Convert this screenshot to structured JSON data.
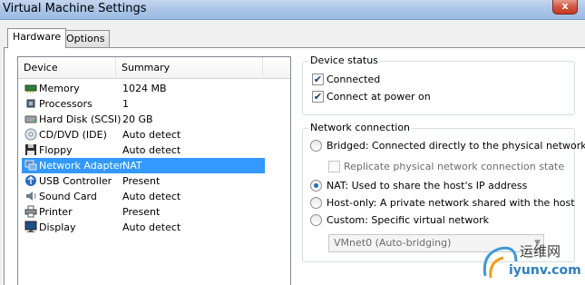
{
  "window": {
    "title": "Virtual Machine Settings",
    "close_glyph": "x"
  },
  "tabs": [
    {
      "label": "Hardware",
      "active": true
    },
    {
      "label": "Options",
      "active": false
    }
  ],
  "device_list": {
    "columns": [
      "Device",
      "Summary"
    ],
    "rows": [
      {
        "device": "Memory",
        "summary": "1024 MB",
        "icon": "memory-icon"
      },
      {
        "device": "Processors",
        "summary": "1",
        "icon": "processor-icon"
      },
      {
        "device": "Hard Disk (SCSI)",
        "summary": "20 GB",
        "icon": "hard-disk-icon"
      },
      {
        "device": "CD/DVD (IDE)",
        "summary": "Auto detect",
        "icon": "cd-dvd-icon"
      },
      {
        "device": "Floppy",
        "summary": "Auto detect",
        "icon": "floppy-icon"
      },
      {
        "device": "Network Adapter",
        "summary": "NAT",
        "icon": "network-adapter-icon",
        "selected": true
      },
      {
        "device": "USB Controller",
        "summary": "Present",
        "icon": "usb-icon"
      },
      {
        "device": "Sound Card",
        "summary": "Auto detect",
        "icon": "sound-card-icon"
      },
      {
        "device": "Printer",
        "summary": "Present",
        "icon": "printer-icon"
      },
      {
        "device": "Display",
        "summary": "Auto detect",
        "icon": "display-icon"
      }
    ]
  },
  "device_status": {
    "label": "Device status",
    "connected": {
      "label": "Connected",
      "checked": true
    },
    "connect_at_power_on": {
      "label": "Connect at power on",
      "checked": true
    }
  },
  "network_connection": {
    "label": "Network connection",
    "bridged": {
      "label": "Bridged: Connected directly to the physical network",
      "checked": false
    },
    "replicate": {
      "label": "Replicate physical network connection state",
      "checked": false,
      "disabled": true
    },
    "nat": {
      "label": "NAT: Used to share the host's IP address",
      "checked": true
    },
    "host_only": {
      "label": "Host-only: A private network shared with the host",
      "checked": false
    },
    "custom": {
      "label": "Custom: Specific virtual network",
      "checked": false
    },
    "custom_network_value": "VMnet0 (Auto-bridging)"
  },
  "watermark": {
    "line1": "运维网",
    "line2": "iyunv.com"
  },
  "colors": {
    "selection": "#3399ff",
    "title_bar": "#a9c4e7",
    "checkmark": "#1d3a6b"
  }
}
